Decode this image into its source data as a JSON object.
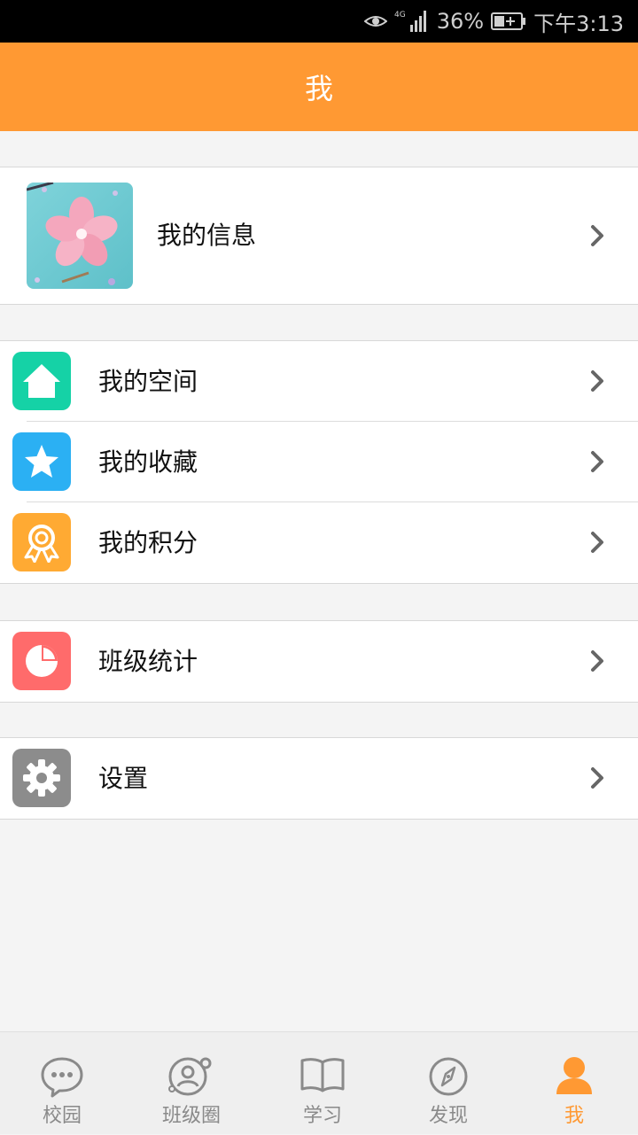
{
  "status_bar": {
    "battery": "36%",
    "time": "下午3:13",
    "network": "4G"
  },
  "header": {
    "title": "我"
  },
  "profile": {
    "label": "我的信息"
  },
  "menu_groups": [
    {
      "items": [
        {
          "label": "我的空间",
          "icon": "home-icon",
          "color": "#15d2a6"
        },
        {
          "label": "我的收藏",
          "icon": "star-icon",
          "color": "#2bb0f3"
        },
        {
          "label": "我的积分",
          "icon": "badge-icon",
          "color": "#ffaa33"
        }
      ]
    },
    {
      "items": [
        {
          "label": "班级统计",
          "icon": "pie-chart-icon",
          "color": "#ff6b6b"
        }
      ]
    },
    {
      "items": [
        {
          "label": "设置",
          "icon": "gear-icon",
          "color": "#8c8c8c"
        }
      ]
    }
  ],
  "tab_bar": {
    "tabs": [
      {
        "label": "校园",
        "icon": "chat-bubble-icon",
        "active": false
      },
      {
        "label": "班级圈",
        "icon": "group-icon",
        "active": false
      },
      {
        "label": "学习",
        "icon": "book-icon",
        "active": false
      },
      {
        "label": "发现",
        "icon": "compass-icon",
        "active": false
      },
      {
        "label": "我",
        "icon": "person-icon",
        "active": true
      }
    ],
    "active_color": "#ff9933",
    "inactive_color": "#8a8a8a"
  },
  "theme": {
    "accent": "#ff9933"
  }
}
